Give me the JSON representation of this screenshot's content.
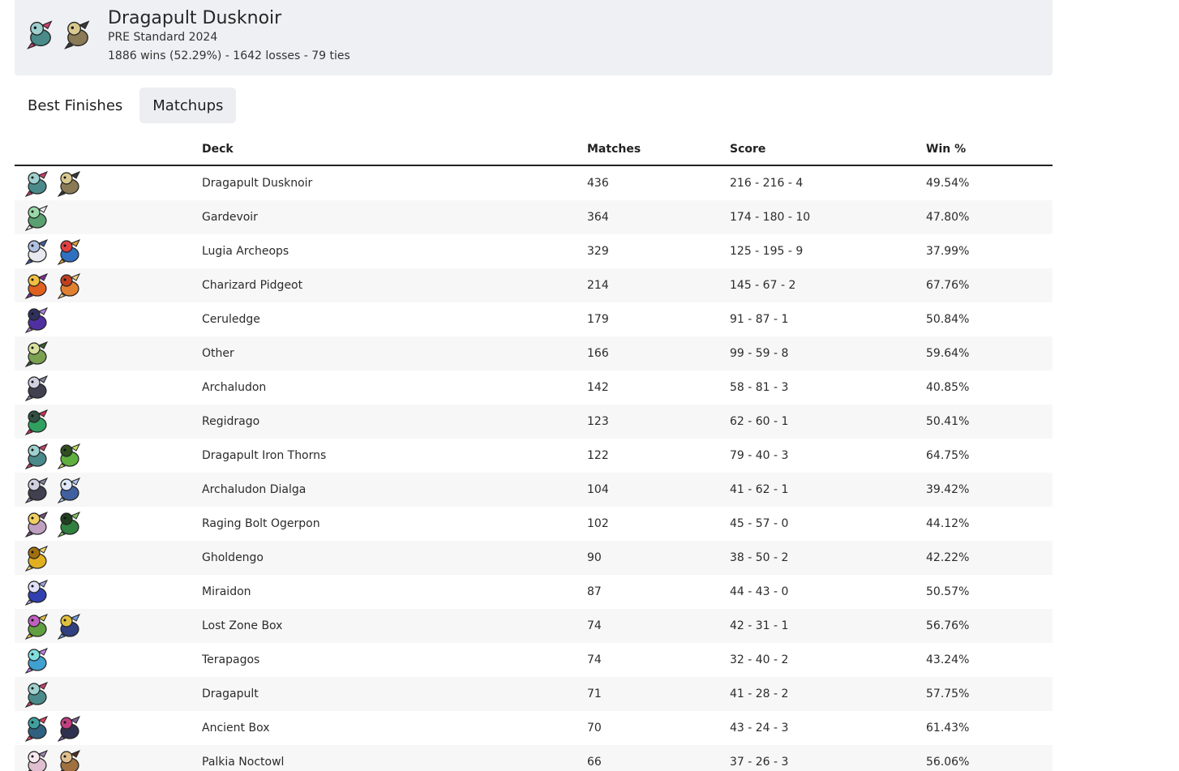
{
  "header": {
    "title": "Dragapult Dusknoir",
    "format": "PRE Standard 2024",
    "record": "1886 wins (52.29%) - 1642 losses - 79 ties",
    "icons": [
      "dragapult-icon",
      "dusknoir-icon"
    ]
  },
  "tabs": [
    {
      "label": "Best Finishes",
      "active": false
    },
    {
      "label": "Matchups",
      "active": true
    }
  ],
  "table": {
    "columns": [
      "",
      "Deck",
      "Matches",
      "Score",
      "Win %"
    ],
    "rows": [
      {
        "deck": "Dragapult Dusknoir",
        "matches": "436",
        "score": "216 - 216 - 4",
        "win": "49.54%",
        "icons": [
          "dragapult-icon",
          "dusknoir-icon"
        ]
      },
      {
        "deck": "Gardevoir",
        "matches": "364",
        "score": "174 - 180 - 10",
        "win": "47.80%",
        "icons": [
          "gardevoir-icon"
        ]
      },
      {
        "deck": "Lugia Archeops",
        "matches": "329",
        "score": "125 - 195 - 9",
        "win": "37.99%",
        "icons": [
          "lugia-icon",
          "archeops-icon"
        ]
      },
      {
        "deck": "Charizard Pidgeot",
        "matches": "214",
        "score": "145 - 67 - 2",
        "win": "67.76%",
        "icons": [
          "charizard-icon",
          "pidgeot-icon"
        ]
      },
      {
        "deck": "Ceruledge",
        "matches": "179",
        "score": "91 - 87 - 1",
        "win": "50.84%",
        "icons": [
          "ceruledge-icon"
        ]
      },
      {
        "deck": "Other",
        "matches": "166",
        "score": "99 - 59 - 8",
        "win": "59.64%",
        "icons": [
          "substitute-icon"
        ]
      },
      {
        "deck": "Archaludon",
        "matches": "142",
        "score": "58 - 81 - 3",
        "win": "40.85%",
        "icons": [
          "archaludon-icon"
        ]
      },
      {
        "deck": "Regidrago",
        "matches": "123",
        "score": "62 - 60 - 1",
        "win": "50.41%",
        "icons": [
          "regidrago-icon"
        ]
      },
      {
        "deck": "Dragapult Iron Thorns",
        "matches": "122",
        "score": "79 - 40 - 3",
        "win": "64.75%",
        "icons": [
          "dragapult-icon",
          "iron-thorns-icon"
        ]
      },
      {
        "deck": "Archaludon Dialga",
        "matches": "104",
        "score": "41 - 62 - 1",
        "win": "39.42%",
        "icons": [
          "archaludon-icon",
          "dialga-icon"
        ]
      },
      {
        "deck": "Raging Bolt Ogerpon",
        "matches": "102",
        "score": "45 - 57 - 0",
        "win": "44.12%",
        "icons": [
          "raging-bolt-icon",
          "ogerpon-icon"
        ]
      },
      {
        "deck": "Gholdengo",
        "matches": "90",
        "score": "38 - 50 - 2",
        "win": "42.22%",
        "icons": [
          "gholdengo-icon"
        ]
      },
      {
        "deck": "Miraidon",
        "matches": "87",
        "score": "44 - 43 - 0",
        "win": "50.57%",
        "icons": [
          "miraidon-icon"
        ]
      },
      {
        "deck": "Lost Zone Box",
        "matches": "74",
        "score": "42 - 31 - 1",
        "win": "56.76%",
        "icons": [
          "comfey-icon",
          "sableye-icon"
        ]
      },
      {
        "deck": "Terapagos",
        "matches": "74",
        "score": "32 - 40 - 2",
        "win": "43.24%",
        "icons": [
          "terapagos-icon"
        ]
      },
      {
        "deck": "Dragapult",
        "matches": "71",
        "score": "41 - 28 - 2",
        "win": "57.75%",
        "icons": [
          "dragapult-icon"
        ]
      },
      {
        "deck": "Ancient Box",
        "matches": "70",
        "score": "43 - 24 - 3",
        "win": "61.43%",
        "icons": [
          "roaring-moon-icon",
          "flutter-mane-icon"
        ]
      },
      {
        "deck": "Palkia Noctowl",
        "matches": "66",
        "score": "37 - 26 - 3",
        "win": "56.06%",
        "icons": [
          "palkia-icon",
          "noctowl-icon"
        ]
      }
    ]
  }
}
